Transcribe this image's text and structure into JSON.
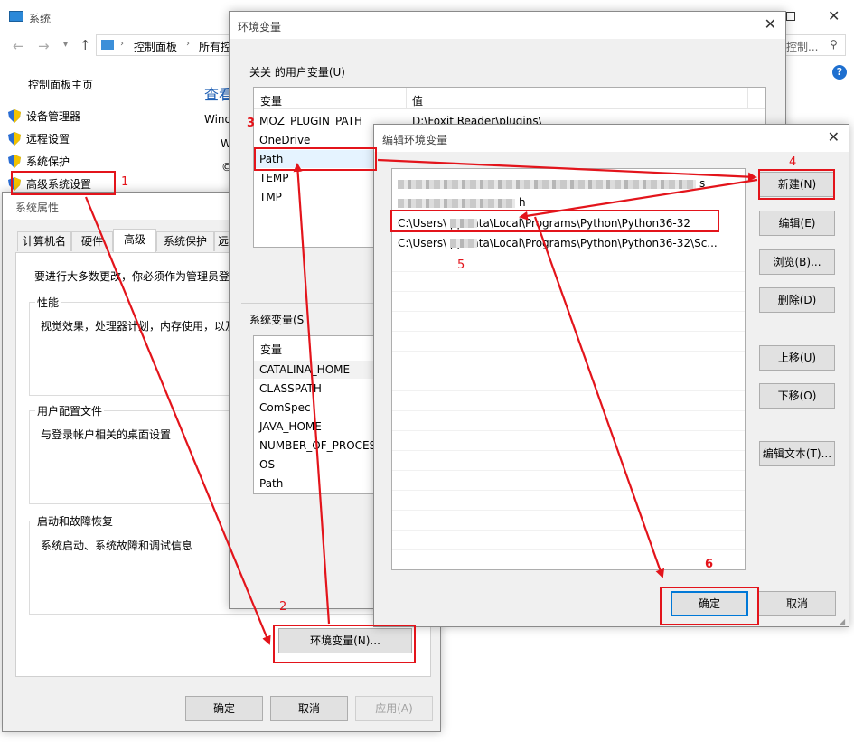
{
  "system_window": {
    "title": "系统",
    "breadcrumb_1": "控制面板",
    "breadcrumb_2": "所有控",
    "search_placeholder": "控制...",
    "help": "?",
    "sidebar_home": "控制面板主页",
    "sidebar_items": [
      "设备管理器",
      "远程设置",
      "系统保护",
      "高级系统设置"
    ],
    "main_view_label": "查看",
    "main_line_1": "Wind",
    "main_line_2": "W",
    "main_line_3": "©"
  },
  "sys_props": {
    "title": "系统属性",
    "tabs": [
      "计算机名",
      "硬件",
      "高级",
      "系统保护",
      "远程"
    ],
    "admin_note": "要进行大多数更改，你必须作为管理员登",
    "perf_group": "性能",
    "perf_desc": "视觉效果，处理器计划，内存使用，以及",
    "profile_group": "用户配置文件",
    "profile_desc": "与登录帐户相关的桌面设置",
    "startup_group": "启动和故障恢复",
    "startup_desc": "系统启动、系统故障和调试信息",
    "env_button": "环境变量(N)...",
    "ok": "确定",
    "cancel": "取消",
    "apply": "应用(A)"
  },
  "env_vars": {
    "title": "环境变量",
    "user_group": "关关 的用户变量(U)",
    "col_var": "变量",
    "col_val": "值",
    "user_vars": [
      {
        "name": "MOZ_PLUGIN_PATH",
        "value": "D:\\Foxit Reader\\plugins\\"
      },
      {
        "name": "OneDrive",
        "value": ""
      },
      {
        "name": "Path",
        "value": ""
      },
      {
        "name": "TEMP",
        "value": ""
      },
      {
        "name": "TMP",
        "value": ""
      }
    ],
    "sys_group": "系统变量(S",
    "sys_col_var": "变量",
    "sys_vars": [
      "CATALINA_HOME",
      "CLASSPATH",
      "ComSpec",
      "JAVA_HOME",
      "NUMBER_OF_PROCES",
      "OS",
      "Path"
    ]
  },
  "edit_env": {
    "title": "编辑环境变量",
    "entries": [
      "s",
      "h",
      "C:\\Users\\   ppData\\Local\\Programs\\Python\\Python36-32",
      "C:\\Users\\   ppData\\Local\\Programs\\Python\\Python36-32\\Sc..."
    ],
    "buttons": [
      "新建(N)",
      "编辑(E)",
      "浏览(B)...",
      "删除(D)",
      "上移(U)",
      "下移(O)",
      "编辑文本(T)..."
    ],
    "ok": "确定",
    "cancel": "取消"
  },
  "annotations": {
    "step1": "1",
    "step2": "2",
    "step3": "3",
    "step4": "4",
    "step5": "5",
    "step6": "6",
    "color": "#e3141b"
  }
}
